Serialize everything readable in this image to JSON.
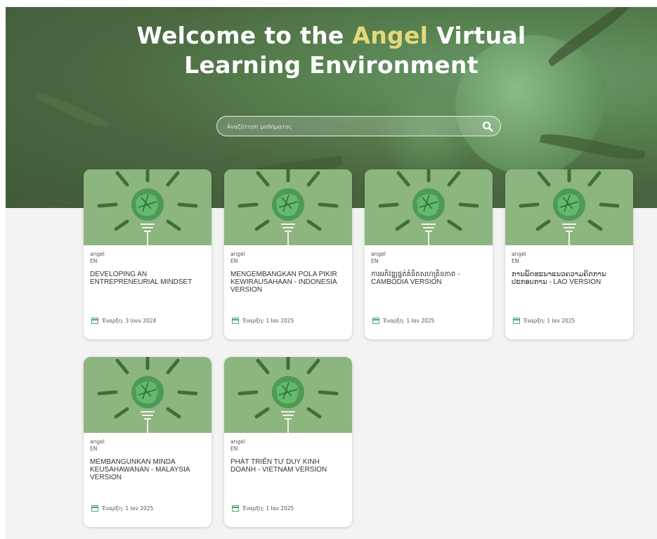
{
  "hero": {
    "title_part1": "Welcome to the ",
    "title_accent": "Angel",
    "title_part2": " Virtual",
    "title_line2": "Learning Environment",
    "search_placeholder": "Αναζήτηση μαθήματος",
    "search_icon": "search-icon"
  },
  "colors": {
    "accent": "#e4d97a",
    "hero_bg": "#4e6b45",
    "calendar": "#4aa36a"
  },
  "courses": [
    {
      "author": "angel",
      "lang": "EN",
      "title": "DEVELOPING AN ENTREPRENEURIAL MINDSET",
      "date": "Έναρξη: 3 Ιουν 2024"
    },
    {
      "author": "angel",
      "lang": "EN",
      "title": "MENGEMBANGKAN POLA PIKIR KEWIRAUSAHAAN - INDONESIA VERSION",
      "date": "Έναρξη: 1 Ιαν 2025"
    },
    {
      "author": "angel",
      "lang": "EN",
      "title": "ការអភិវឌ្ឍផ្នត់គំនិតសហគ្រិនភាព - CAMBODIA VERSION",
      "date": "Έναρξη: 1 Ιαν 2025"
    },
    {
      "author": "angel",
      "lang": "EN",
      "title": "ການພັດທະນາແນວຄວາມຄິດການປະກອບການ - LAO VERSION",
      "date": "Έναρξη: 1 Ιαν 2025"
    },
    {
      "author": "angel",
      "lang": "EN",
      "title": "MEMBANGUNKAN MINDA KEUSAHAWANAN - MALAYSIA VERSION",
      "date": "Έναρξη: 1 Ιαν 2025"
    },
    {
      "author": "angel",
      "lang": "EN",
      "title": "PHÁT TRIỂN TƯ DUY KINH DOANH - VIETNAM VERSION",
      "date": "Έναρξη: 1 Ιαν 2025"
    }
  ]
}
